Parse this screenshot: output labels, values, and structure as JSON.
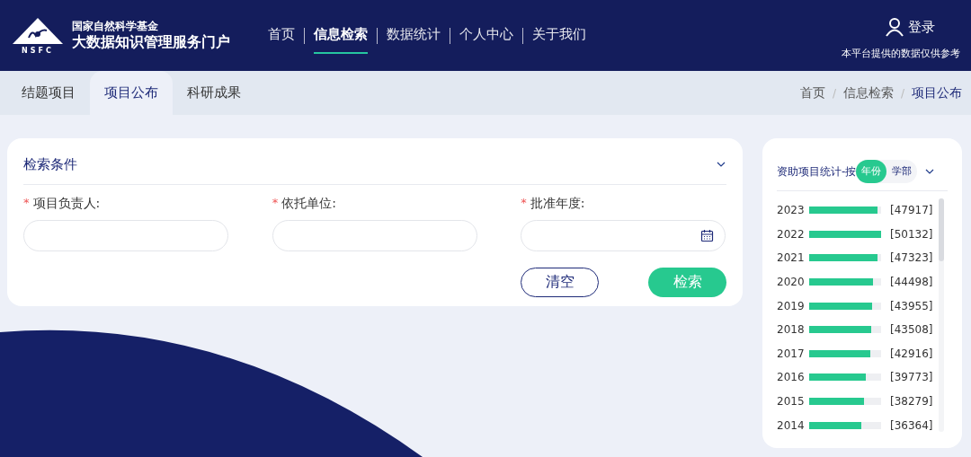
{
  "header": {
    "org_name": "国家自然科学基金",
    "portal_name": "大数据知识管理服务门户",
    "logo_text": "NSFC",
    "nav": [
      {
        "label": "首页",
        "selected": false
      },
      {
        "label": "信息检索",
        "selected": true
      },
      {
        "label": "数据统计",
        "selected": false
      },
      {
        "label": "个人中心",
        "selected": false
      },
      {
        "label": "关于我们",
        "selected": false
      }
    ],
    "login": "登录",
    "notice": "本平台提供的数据仅供参考"
  },
  "tabs": [
    {
      "label": "结题项目",
      "selected": false
    },
    {
      "label": "项目公布",
      "selected": true
    },
    {
      "label": "科研成果",
      "selected": false
    }
  ],
  "breadcrumb": [
    {
      "label": "首页",
      "selected": false
    },
    {
      "label": "信息检索",
      "selected": false
    },
    {
      "label": "项目公布",
      "selected": true
    }
  ],
  "breadcrumb_separator": "/",
  "search": {
    "title": "检索条件",
    "fields": [
      {
        "label": "项目负责人:",
        "mark": "*",
        "kind": "text"
      },
      {
        "label": "依托单位:",
        "mark": "*",
        "kind": "text"
      },
      {
        "label": "批准年度:",
        "mark": "*",
        "kind": "date"
      }
    ],
    "buttons": [
      {
        "label": "清空",
        "kind": "outline"
      },
      {
        "label": "检索",
        "kind": "primary"
      }
    ]
  },
  "stats": {
    "title": "资助项目统计-按",
    "toggle": [
      {
        "label": "年份",
        "selected": true
      },
      {
        "label": "学部",
        "selected": false
      }
    ],
    "rows": [
      {
        "year": "2023",
        "count": "[47917]",
        "level": 0.956
      },
      {
        "year": "2022",
        "count": "[50132]",
        "level": 1.0
      },
      {
        "year": "2021",
        "count": "[47323]",
        "level": 0.944
      },
      {
        "year": "2020",
        "count": "[44498]",
        "level": 0.888
      },
      {
        "year": "2019",
        "count": "[43955]",
        "level": 0.877
      },
      {
        "year": "2018",
        "count": "[43508]",
        "level": 0.868
      },
      {
        "year": "2017",
        "count": "[42916]",
        "level": 0.856
      },
      {
        "year": "2016",
        "count": "[39773]",
        "level": 0.793
      },
      {
        "year": "2015",
        "count": "[38279]",
        "level": 0.764
      },
      {
        "year": "2014",
        "count": "[36364]",
        "level": 0.725
      }
    ]
  }
}
